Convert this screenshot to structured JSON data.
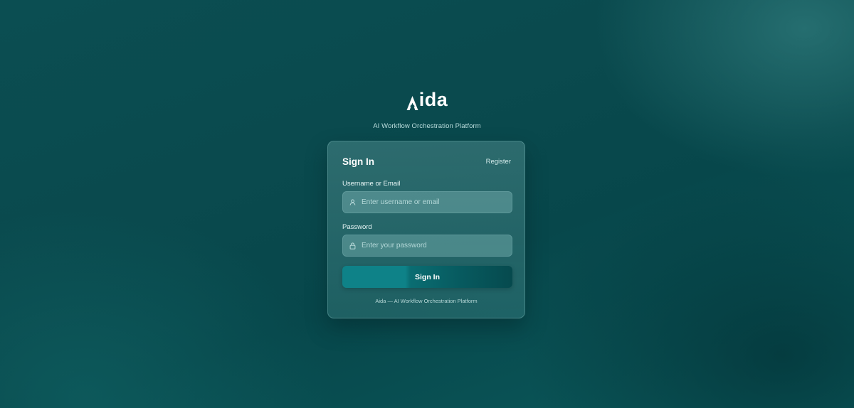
{
  "brand": {
    "name": "Aida",
    "tagline": "AI Workflow Orchestration Platform"
  },
  "card": {
    "title": "Sign In",
    "register_link": "Register",
    "username": {
      "label": "Username or Email",
      "placeholder": "Enter username or email",
      "value": ""
    },
    "password": {
      "label": "Password",
      "placeholder": "Enter your password",
      "value": ""
    },
    "submit_label": "Sign In",
    "footer": "Aida — AI Workflow Orchestration Platform"
  },
  "icons": {
    "username_field": "user-icon",
    "password_field": "lock-icon"
  },
  "colors": {
    "background": "#0a4a4e",
    "button_start": "#0e8288",
    "button_end": "#064a4e",
    "text": "#ffffff"
  }
}
